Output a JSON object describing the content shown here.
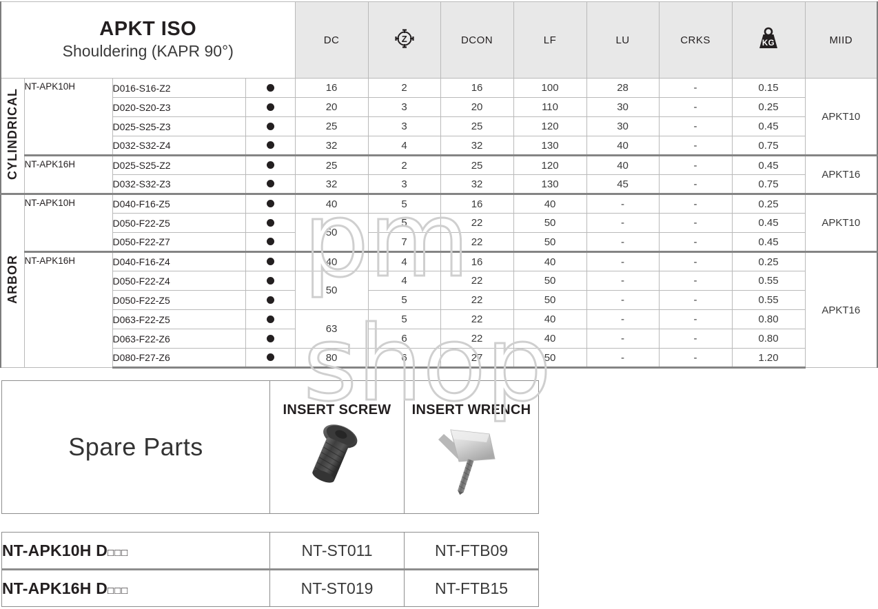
{
  "header": {
    "title_main": "APKT ISO",
    "title_sub": "Shouldering (KAPR 90°)",
    "columns": [
      {
        "key": "dc",
        "label": "DC",
        "icon": null
      },
      {
        "key": "z",
        "label": "",
        "icon": "z-target-icon"
      },
      {
        "key": "dcon",
        "label": "DCON",
        "icon": null
      },
      {
        "key": "lf",
        "label": "LF",
        "icon": null
      },
      {
        "key": "lu",
        "label": "LU",
        "icon": null
      },
      {
        "key": "crks",
        "label": "CRKS",
        "icon": null
      },
      {
        "key": "kg",
        "label": "KG",
        "icon": "weight-kg-icon"
      },
      {
        "key": "miid",
        "label": "MIID",
        "icon": null
      }
    ]
  },
  "groups": [
    {
      "name": "CYLINDRICAL",
      "families": [
        {
          "family": "NT-APK10H",
          "miid": "APKT10",
          "rows": [
            {
              "code": "D016-S16-Z2",
              "avail": "●",
              "dc": "16",
              "z": "2",
              "dcon": "16",
              "lf": "100",
              "lu": "28",
              "crks": "-",
              "kg": "0.15"
            },
            {
              "code": "D020-S20-Z3",
              "avail": "●",
              "dc": "20",
              "z": "3",
              "dcon": "20",
              "lf": "110",
              "lu": "30",
              "crks": "-",
              "kg": "0.25"
            },
            {
              "code": "D025-S25-Z3",
              "avail": "●",
              "dc": "25",
              "z": "3",
              "dcon": "25",
              "lf": "120",
              "lu": "30",
              "crks": "-",
              "kg": "0.45"
            },
            {
              "code": "D032-S32-Z4",
              "avail": "●",
              "dc": "32",
              "z": "4",
              "dcon": "32",
              "lf": "130",
              "lu": "40",
              "crks": "-",
              "kg": "0.75"
            }
          ]
        },
        {
          "family": "NT-APK16H",
          "miid": "APKT16",
          "rows": [
            {
              "code": "D025-S25-Z2",
              "avail": "●",
              "dc": "25",
              "z": "2",
              "dcon": "25",
              "lf": "120",
              "lu": "40",
              "crks": "-",
              "kg": "0.45"
            },
            {
              "code": "D032-S32-Z3",
              "avail": "●",
              "dc": "32",
              "z": "3",
              "dcon": "32",
              "lf": "130",
              "lu": "45",
              "crks": "-",
              "kg": "0.75"
            }
          ]
        }
      ]
    },
    {
      "name": "ARBOR",
      "families": [
        {
          "family": "NT-APK10H",
          "miid": "APKT10",
          "rows": [
            {
              "code": "D040-F16-Z5",
              "avail": "●",
              "dc": "40",
              "dc_span": 1,
              "z": "5",
              "dcon": "16",
              "lf": "40",
              "lu": "-",
              "crks": "-",
              "kg": "0.25"
            },
            {
              "code": "D050-F22-Z5",
              "avail": "●",
              "dc": "50",
              "dc_span": 2,
              "z": "5",
              "dcon": "22",
              "lf": "50",
              "lu": "-",
              "crks": "-",
              "kg": "0.45"
            },
            {
              "code": "D050-F22-Z7",
              "avail": "●",
              "dc": "",
              "dc_span": 0,
              "z": "7",
              "dcon": "22",
              "lf": "50",
              "lu": "-",
              "crks": "-",
              "kg": "0.45"
            }
          ]
        },
        {
          "family": "NT-APK16H",
          "miid": "APKT16",
          "rows": [
            {
              "code": "D040-F16-Z4",
              "avail": "●",
              "dc": "40",
              "dc_span": 1,
              "z": "4",
              "dcon": "16",
              "lf": "40",
              "lu": "-",
              "crks": "-",
              "kg": "0.25"
            },
            {
              "code": "D050-F22-Z4",
              "avail": "●",
              "dc": "50",
              "dc_span": 2,
              "z": "4",
              "dcon": "22",
              "lf": "50",
              "lu": "-",
              "crks": "-",
              "kg": "0.55"
            },
            {
              "code": "D050-F22-Z5",
              "avail": "●",
              "dc": "",
              "dc_span": 0,
              "z": "5",
              "dcon": "22",
              "lf": "50",
              "lu": "-",
              "crks": "-",
              "kg": "0.55"
            },
            {
              "code": "D063-F22-Z5",
              "avail": "●",
              "dc": "63",
              "dc_span": 2,
              "z": "5",
              "dcon": "22",
              "lf": "40",
              "lu": "-",
              "crks": "-",
              "kg": "0.80"
            },
            {
              "code": "D063-F22-Z6",
              "avail": "●",
              "dc": "",
              "dc_span": 0,
              "z": "6",
              "dcon": "22",
              "lf": "40",
              "lu": "-",
              "crks": "-",
              "kg": "0.80"
            },
            {
              "code": "D080-F27-Z6",
              "avail": "●",
              "dc": "80",
              "dc_span": 1,
              "z": "6",
              "dcon": "27",
              "lf": "50",
              "lu": "-",
              "crks": "-",
              "kg": "1.20"
            }
          ]
        }
      ]
    }
  ],
  "spare_parts": {
    "title": "Spare Parts",
    "screw_header": "INSERT SCREW",
    "wrench_header": "INSERT WRENCH",
    "screw_icon": "insert-screw-photo",
    "wrench_icon": "insert-wrench-photo"
  },
  "reference": {
    "rows": [
      {
        "name": "NT-APK10H D",
        "boxes": "□□□",
        "screw": "NT-ST011",
        "wrench": "NT-FTB09"
      },
      {
        "name": "NT-APK16H D",
        "boxes": "□□□",
        "screw": "NT-ST019",
        "wrench": "NT-FTB15"
      }
    ]
  },
  "watermark": {
    "line1": "pm",
    "line2": "shop"
  },
  "colors": {
    "header_bg": "#e8e8e8",
    "ink": "#231f20",
    "rule": "#b9b9b9",
    "thick_rule": "#848484",
    "watermark": "#cfcfcf"
  }
}
